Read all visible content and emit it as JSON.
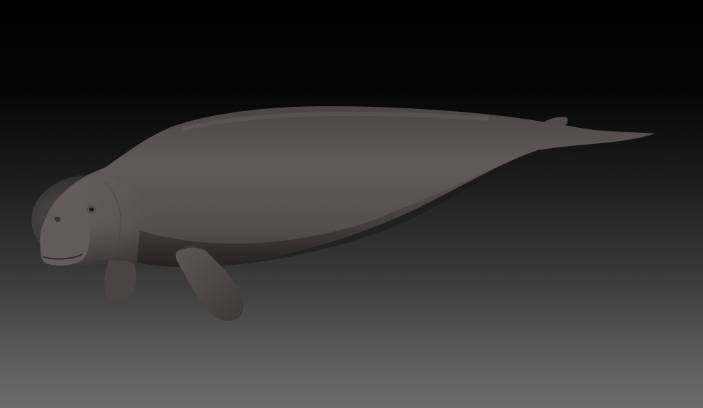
{
  "viewport": {
    "background_top": "#000000",
    "background_bottom": "#6b6b6b"
  },
  "subject": {
    "name": "dugong",
    "skin_color": "#5a5454",
    "skin_highlight": "#7a7272",
    "skin_shadow": "#2e2a2a"
  }
}
